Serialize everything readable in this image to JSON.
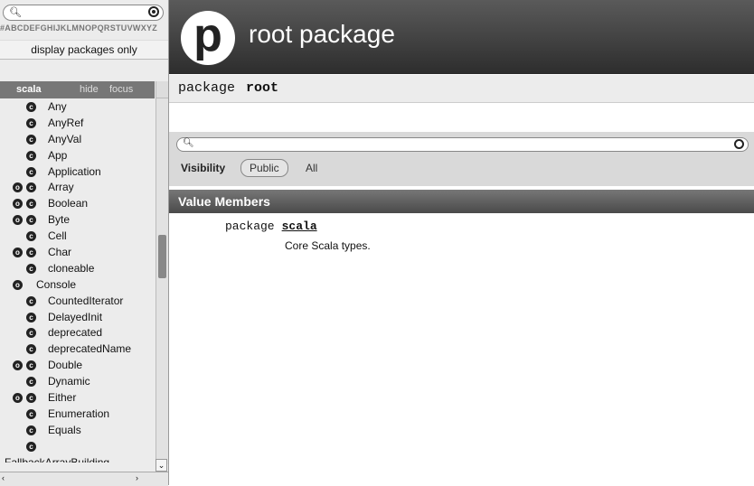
{
  "sidebar": {
    "search_placeholder": "",
    "letters": "#ABCDEFGHIJKLMNOPQRSTUVWXYZ",
    "display_packages_only": "display packages only",
    "package_name": "scala",
    "hide": "hide",
    "focus": "focus",
    "items": [
      {
        "name": "Any",
        "object": false,
        "class": true
      },
      {
        "name": "AnyRef",
        "object": false,
        "class": true
      },
      {
        "name": "AnyVal",
        "object": false,
        "class": true
      },
      {
        "name": "App",
        "object": false,
        "class": true
      },
      {
        "name": "Application",
        "object": false,
        "class": true
      },
      {
        "name": "Array",
        "object": true,
        "class": true
      },
      {
        "name": "Boolean",
        "object": true,
        "class": true
      },
      {
        "name": "Byte",
        "object": true,
        "class": true
      },
      {
        "name": "Cell",
        "object": false,
        "class": true
      },
      {
        "name": "Char",
        "object": true,
        "class": true
      },
      {
        "name": "cloneable",
        "object": false,
        "class": true
      },
      {
        "name": "Console",
        "object": true,
        "class": false
      },
      {
        "name": "CountedIterator",
        "object": false,
        "class": true
      },
      {
        "name": "DelayedInit",
        "object": false,
        "class": true
      },
      {
        "name": "deprecated",
        "object": false,
        "class": true
      },
      {
        "name": "deprecatedName",
        "object": false,
        "class": true
      },
      {
        "name": "Double",
        "object": true,
        "class": true
      },
      {
        "name": "Dynamic",
        "object": false,
        "class": true
      },
      {
        "name": "Either",
        "object": true,
        "class": true
      },
      {
        "name": "Enumeration",
        "object": false,
        "class": true
      },
      {
        "name": "Equals",
        "object": false,
        "class": true
      },
      {
        "name": "",
        "object": false,
        "class": true
      },
      {
        "name": "FallbackArrayBuilding",
        "object": false,
        "class": false
      }
    ]
  },
  "main": {
    "logo_letter": "p",
    "title": "root package",
    "signature_keyword": "package",
    "signature_name": "root",
    "filter": {
      "visibility_label": "Visibility",
      "public": "Public",
      "all": "All"
    },
    "value_members_header": "Value Members",
    "member": {
      "keyword": "package",
      "name": "scala",
      "description": "Core Scala types."
    }
  }
}
